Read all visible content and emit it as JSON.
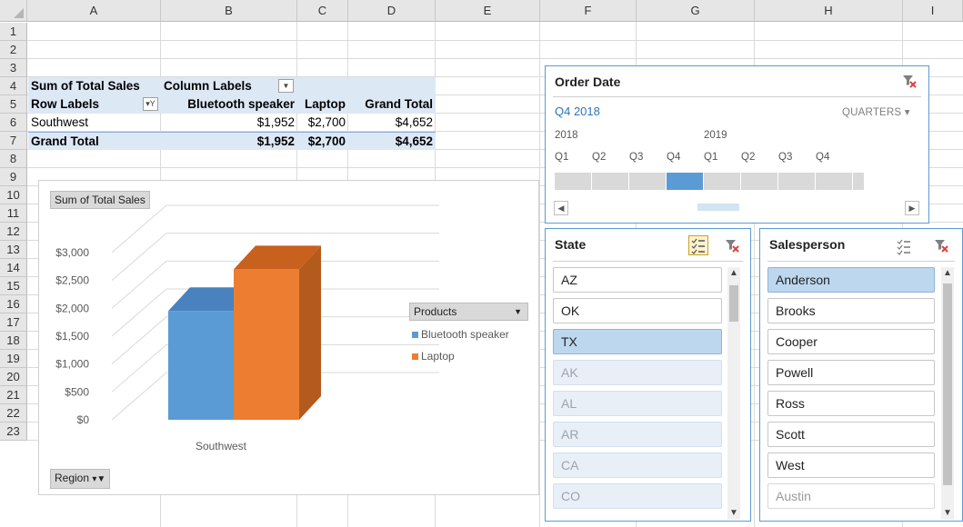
{
  "columns": [
    "A",
    "B",
    "C",
    "D",
    "E",
    "F",
    "G",
    "H",
    "I"
  ],
  "rows": [
    "1",
    "2",
    "3",
    "4",
    "5",
    "6",
    "7",
    "8",
    "9",
    "10",
    "11",
    "12",
    "13",
    "14",
    "15",
    "16",
    "17",
    "18",
    "19",
    "20",
    "21",
    "22",
    "23"
  ],
  "pivot": {
    "values_label": "Sum of Total Sales",
    "column_labels": "Column Labels",
    "row_labels": "Row Labels",
    "headers": [
      "Bluetooth speaker",
      "Laptop",
      "Grand Total"
    ],
    "rows": [
      {
        "label": "Southwest",
        "values": [
          "$1,952",
          "$2,700",
          "$4,652"
        ]
      },
      {
        "label": "Grand Total",
        "values": [
          "$1,952",
          "$2,700",
          "$4,652"
        ]
      }
    ]
  },
  "chart": {
    "field_button": "Sum of Total Sales",
    "region_button": "Region",
    "legend_title": "Products",
    "category": "Southwest",
    "y_ticks": [
      "$3,000",
      "$2,500",
      "$2,000",
      "$1,500",
      "$1,000",
      "$500",
      "$0"
    ]
  },
  "chart_data": {
    "type": "bar",
    "categories": [
      "Southwest"
    ],
    "series": [
      {
        "name": "Bluetooth speaker",
        "values": [
          1952
        ],
        "color": "#5b9bd5"
      },
      {
        "name": "Laptop",
        "values": [
          2700
        ],
        "color": "#ed7d31"
      }
    ],
    "ylim": [
      0,
      3000
    ]
  },
  "timeline": {
    "title": "Order Date",
    "selected_period": "Q4 2018",
    "level": "QUARTERS",
    "years": [
      "2018",
      "2019"
    ],
    "quarters": [
      "Q1",
      "Q2",
      "Q3",
      "Q4",
      "Q1",
      "Q2",
      "Q3",
      "Q4"
    ],
    "selected_index": 3
  },
  "state_slicer": {
    "title": "State",
    "items": [
      {
        "label": "AZ",
        "state": "available"
      },
      {
        "label": "OK",
        "state": "available"
      },
      {
        "label": "TX",
        "state": "selected"
      },
      {
        "label": "AK",
        "state": "nodata"
      },
      {
        "label": "AL",
        "state": "nodata"
      },
      {
        "label": "AR",
        "state": "nodata"
      },
      {
        "label": "CA",
        "state": "nodata"
      },
      {
        "label": "CO",
        "state": "nodata"
      }
    ]
  },
  "salesperson_slicer": {
    "title": "Salesperson",
    "items": [
      {
        "label": "Anderson",
        "state": "selected"
      },
      {
        "label": "Brooks",
        "state": "available"
      },
      {
        "label": "Cooper",
        "state": "available"
      },
      {
        "label": "Powell",
        "state": "available"
      },
      {
        "label": "Ross",
        "state": "available"
      },
      {
        "label": "Scott",
        "state": "available"
      },
      {
        "label": "West",
        "state": "available"
      },
      {
        "label": "Austin",
        "state": "nodata"
      }
    ]
  }
}
